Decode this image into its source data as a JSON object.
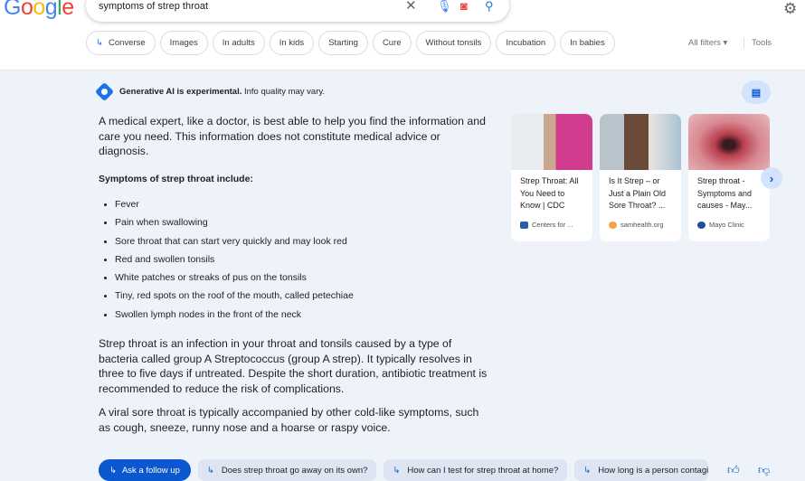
{
  "search": {
    "query": "symptoms of strep throat"
  },
  "chips": [
    "Converse",
    "Images",
    "In adults",
    "In kids",
    "Starting",
    "Cure",
    "Without tonsils",
    "Incubation",
    "In babies"
  ],
  "filters": {
    "all_filters": "All filters",
    "tools": "Tools"
  },
  "ai": {
    "header_bold": "Generative AI is experimental.",
    "header_rest": " Info quality may vary.",
    "intro": "A medical expert, like a doctor, is best able to help you find the information and care you need. This information does not constitute medical advice or diagnosis.",
    "subheading": "Symptoms of strep throat include:",
    "symptoms": [
      "Fever",
      "Pain when swallowing",
      "Sore throat that can start very quickly and may look red",
      "Red and swollen tonsils",
      "White patches or streaks of pus on the tonsils",
      "Tiny, red spots on the roof of the mouth, called petechiae",
      "Swollen lymph nodes in the front of the neck"
    ],
    "para1": "Strep throat is an infection in your throat and tonsils caused by a type of bacteria called group A Streptococcus (group A strep). It typically resolves in three to five days if untreated. Despite the short duration, antibiotic treatment is recommended to reduce the risk of complications.",
    "para2": "A viral sore throat is typically accompanied by other cold-like symptoms, such as cough, sneeze, runny nose and a hoarse or raspy voice."
  },
  "cards": [
    {
      "title": "Strep Throat: All You Need to Know | CDC",
      "source": "Centers for ..."
    },
    {
      "title": "Is It Strep – or Just a Plain Old Sore Throat? ...",
      "source": "samhealth.org"
    },
    {
      "title": "Strep throat - Symptoms and causes - May...",
      "source": "Mayo Clinic"
    }
  ],
  "followup": {
    "button": "Ask a follow up",
    "suggestions": [
      "Does strep throat go away on its own?",
      "How can I test for strep throat at home?",
      "How long is a person contagi"
    ]
  }
}
